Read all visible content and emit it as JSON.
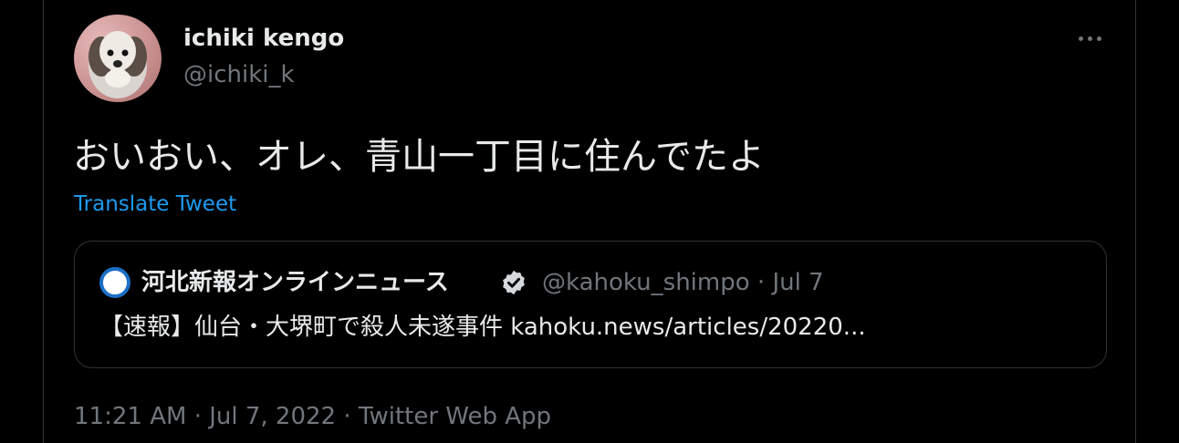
{
  "author": {
    "display_name": "ichiki kengo",
    "handle": "@ichiki_k",
    "avatar_icon": "dog-avatar"
  },
  "more_icon": "more-horizontal-icon",
  "tweet": {
    "text": "おいおい、オレ、青山一丁目に住んでたよ",
    "translate_label": "Translate Tweet"
  },
  "quote": {
    "display_name": "河北新報オンラインニュース",
    "verified_icon": "verified-badge-icon",
    "handle": "@kahoku_shimpo",
    "separator": "·",
    "date": "Jul 7",
    "text": "【速報】仙台・大堺町で殺人未遂事件 kahoku.news/articles/20220..."
  },
  "meta": {
    "time": "11:21 AM",
    "date": "Jul 7, 2022",
    "source": "Twitter Web App",
    "separator": "·"
  },
  "colors": {
    "background": "#000000",
    "text_primary": "#e7e9ea",
    "text_secondary": "#71767b",
    "link": "#1d9bf0",
    "border": "#2f3336"
  }
}
